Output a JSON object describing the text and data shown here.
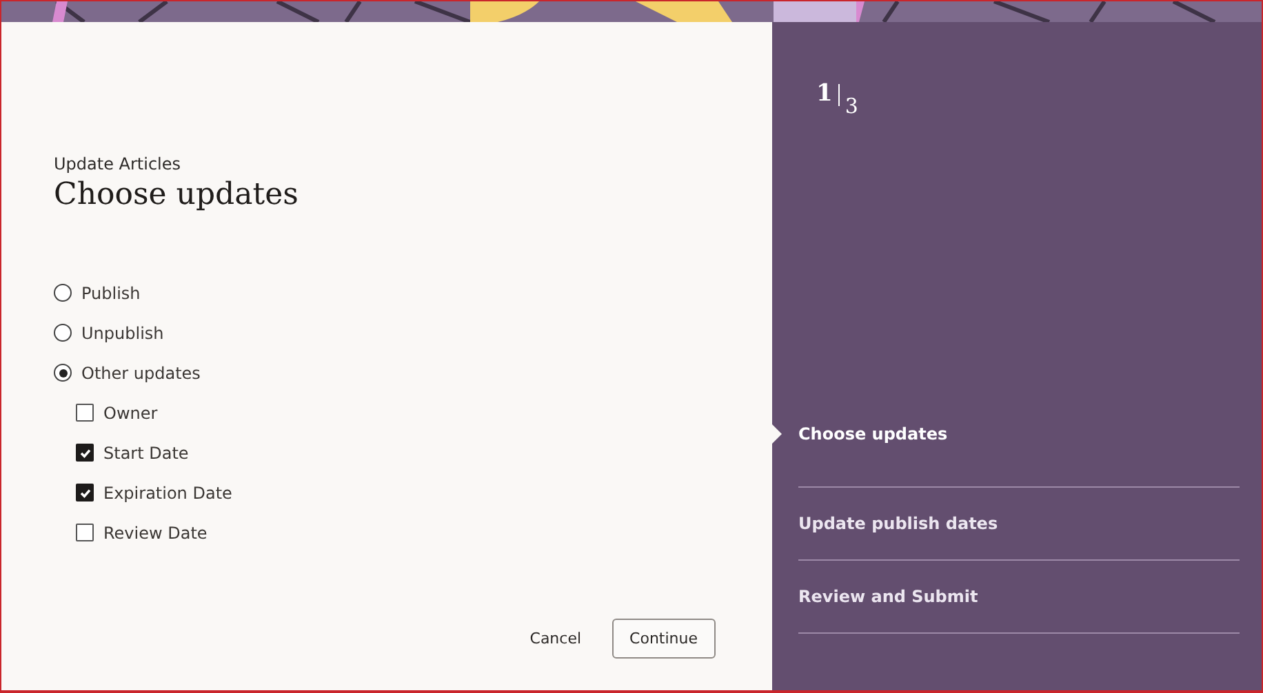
{
  "dialog": {
    "subtitle": "Update Articles",
    "title": "Choose updates"
  },
  "options": [
    {
      "label": "Publish",
      "selected": false
    },
    {
      "label": "Unpublish",
      "selected": false
    },
    {
      "label": "Other updates",
      "selected": true,
      "children": [
        {
          "label": "Owner",
          "checked": false
        },
        {
          "label": "Start Date",
          "checked": true
        },
        {
          "label": "Expiration Date",
          "checked": true
        },
        {
          "label": "Review Date",
          "checked": false
        }
      ]
    }
  ],
  "buttons": {
    "cancel": "Cancel",
    "continue": "Continue"
  },
  "step_counter": {
    "current": "1",
    "total": "3"
  },
  "steps": [
    {
      "label": "Choose updates",
      "selected": true
    },
    {
      "label": "Update publish dates",
      "selected": false
    },
    {
      "label": "Review and Submit",
      "selected": false
    }
  ]
}
